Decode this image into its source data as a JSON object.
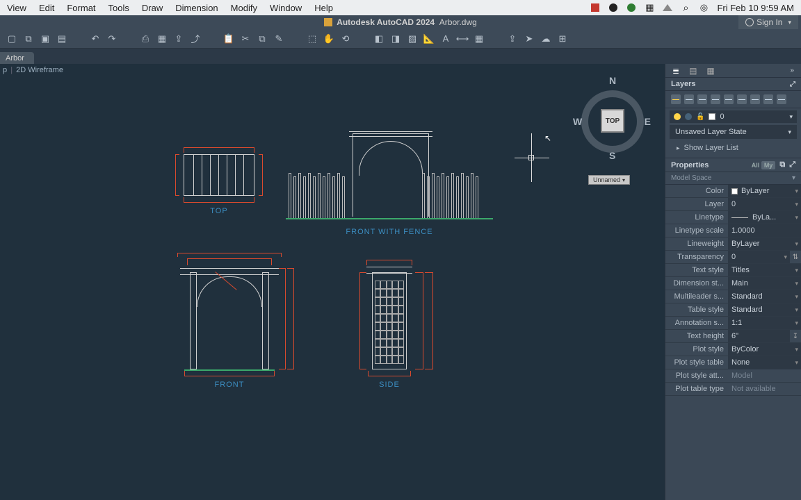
{
  "mac_menu": {
    "items": [
      "View",
      "Edit",
      "Format",
      "Tools",
      "Draw",
      "Dimension",
      "Modify",
      "Window",
      "Help"
    ],
    "datetime": "Fri Feb 10  9:59 AM"
  },
  "title_bar": {
    "app": "Autodesk AutoCAD 2024",
    "file": "Arbor.dwg",
    "signin": "Sign In"
  },
  "doc_tab": "Arbor",
  "viewport": {
    "view": "p",
    "style": "2D Wireframe"
  },
  "viewcube": {
    "face": "TOP",
    "n": "N",
    "s": "S",
    "e": "E",
    "w": "W",
    "named": "Unnamed"
  },
  "views": {
    "top": "TOP",
    "fence": "FRONT WITH FENCE",
    "front": "FRONT",
    "side": "SIDE"
  },
  "layers": {
    "title": "Layers",
    "current": "0",
    "state": "Unsaved Layer State",
    "show": "Show Layer List"
  },
  "properties": {
    "title": "Properties",
    "scope_all": "All",
    "scope_my": "My",
    "selection": "Model Space",
    "rows": [
      {
        "label": "Color",
        "value": "ByLayer",
        "swatch": true,
        "dd": true
      },
      {
        "label": "Layer",
        "value": "0",
        "dd": true
      },
      {
        "label": "Linetype",
        "value": "ByLa...",
        "line": true,
        "dd": true
      },
      {
        "label": "Linetype scale",
        "value": "1.0000"
      },
      {
        "label": "Lineweight",
        "value": "ByLayer",
        "dd": true
      },
      {
        "label": "Transparency",
        "value": "0",
        "dd": true,
        "slider": true
      },
      {
        "label": "Text style",
        "value": "Titles",
        "dd": true
      },
      {
        "label": "Dimension st...",
        "value": "Main",
        "dd": true
      },
      {
        "label": "Multileader s...",
        "value": "Standard",
        "dd": true
      },
      {
        "label": "Table style",
        "value": "Standard",
        "dd": true
      },
      {
        "label": "Annotation s...",
        "value": "1:1",
        "dd": true
      },
      {
        "label": "Text height",
        "value": "6\"",
        "extra": true
      },
      {
        "label": "Plot style",
        "value": "ByColor",
        "dd": true
      },
      {
        "label": "Plot style table",
        "value": "None",
        "dd": true
      },
      {
        "label": "Plot style att...",
        "value": "Model",
        "readonly": true
      },
      {
        "label": "Plot table type",
        "value": "Not available",
        "readonly": true
      }
    ]
  }
}
